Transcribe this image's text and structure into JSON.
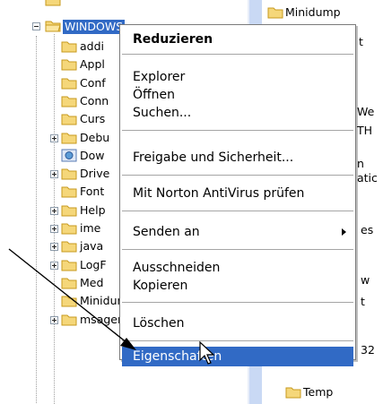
{
  "tree": {
    "root_label": "WINDOWS",
    "children": [
      {
        "label": "addi",
        "expandable": false
      },
      {
        "label": "Appl",
        "expandable": false
      },
      {
        "label": "Conf",
        "expandable": false
      },
      {
        "label": "Conn",
        "expandable": false
      },
      {
        "label": "Curs",
        "expandable": false
      },
      {
        "label": "Debu",
        "expandable": true
      },
      {
        "label": "Dow",
        "expandable": false,
        "special": true
      },
      {
        "label": "Drive",
        "expandable": true
      },
      {
        "label": "Font",
        "expandable": false
      },
      {
        "label": "Help",
        "expandable": true
      },
      {
        "label": "ime",
        "expandable": true
      },
      {
        "label": "java",
        "expandable": true
      },
      {
        "label": "LogF",
        "expandable": true
      },
      {
        "label": "Med",
        "expandable": false
      },
      {
        "label": "Minidump",
        "expandable": false
      },
      {
        "label": "msagent",
        "expandable": true
      }
    ]
  },
  "right_pane": {
    "items": [
      "Minidump",
      "Temp"
    ],
    "fragments": [
      "t",
      "We",
      "TH",
      "n",
      "atic",
      "es",
      "w",
      "t",
      "32"
    ]
  },
  "context_menu": {
    "items": [
      {
        "label": "Reduzieren",
        "bold": true
      },
      {
        "separator": true
      },
      {
        "label": "Explorer"
      },
      {
        "label": "Öffnen"
      },
      {
        "label": "Suchen..."
      },
      {
        "separator": true
      },
      {
        "label": "Freigabe und Sicherheit..."
      },
      {
        "separator": true
      },
      {
        "label": "Mit Norton AntiVirus prüfen"
      },
      {
        "separator": true
      },
      {
        "label": "Senden an",
        "submenu": true
      },
      {
        "separator": true
      },
      {
        "label": "Ausschneiden"
      },
      {
        "label": "Kopieren"
      },
      {
        "separator": true
      },
      {
        "label": "Löschen"
      },
      {
        "separator": true
      },
      {
        "label": "Eigenschaften",
        "highlighted": true
      }
    ]
  },
  "colors": {
    "selection": "#316ac5",
    "folder_fill": "#f5d77a",
    "folder_stroke": "#c79a1e"
  }
}
